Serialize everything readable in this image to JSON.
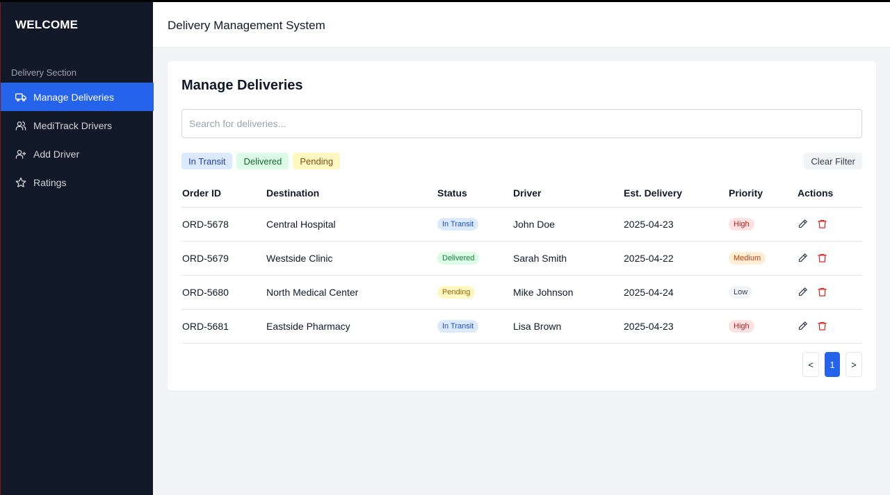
{
  "sidebar": {
    "brand": "WELCOME",
    "section_label": "Delivery Section",
    "items": [
      {
        "label": "Manage Deliveries",
        "icon": "truck-icon",
        "active": true
      },
      {
        "label": "MediTrack Drivers",
        "icon": "users-icon",
        "active": false
      },
      {
        "label": "Add Driver",
        "icon": "user-plus-icon",
        "active": false
      },
      {
        "label": "Ratings",
        "icon": "star-icon",
        "active": false
      }
    ]
  },
  "header": {
    "title": "Delivery Management System"
  },
  "main": {
    "title": "Manage Deliveries",
    "search": {
      "placeholder": "Search for deliveries...",
      "value": ""
    },
    "filters": [
      "In Transit",
      "Delivered",
      "Pending"
    ],
    "clear_filter_label": "Clear Filter",
    "table": {
      "columns": [
        "Order ID",
        "Destination",
        "Status",
        "Driver",
        "Est. Delivery",
        "Priority",
        "Actions"
      ],
      "rows": [
        {
          "order_id": "ORD-5678",
          "destination": "Central Hospital",
          "status": "In Transit",
          "driver": "John Doe",
          "est_delivery": "2025-04-23",
          "priority": "High"
        },
        {
          "order_id": "ORD-5679",
          "destination": "Westside Clinic",
          "status": "Delivered",
          "driver": "Sarah Smith",
          "est_delivery": "2025-04-22",
          "priority": "Medium"
        },
        {
          "order_id": "ORD-5680",
          "destination": "North Medical Center",
          "status": "Pending",
          "driver": "Mike Johnson",
          "est_delivery": "2025-04-24",
          "priority": "Low"
        },
        {
          "order_id": "ORD-5681",
          "destination": "Eastside Pharmacy",
          "status": "In Transit",
          "driver": "Lisa Brown",
          "est_delivery": "2025-04-23",
          "priority": "High"
        }
      ]
    },
    "pagination": {
      "prev": "<",
      "current": "1",
      "next": ">"
    }
  },
  "colors": {
    "sidebar_bg": "#111827",
    "accent": "#2563eb",
    "delete_icon": "#dc2626"
  }
}
